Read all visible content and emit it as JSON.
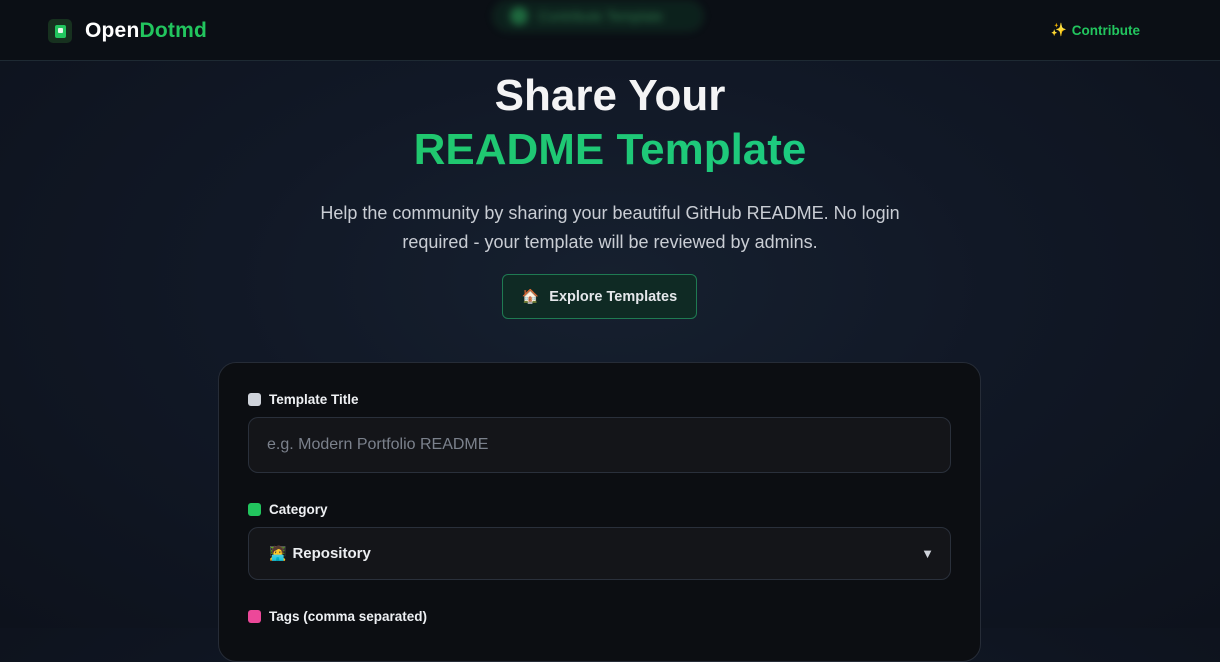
{
  "nav": {
    "brand_part1": "Open",
    "brand_part2": "Dotmd",
    "faded_pill_text": "Contribute Template",
    "contribute_label": "Contribute"
  },
  "hero": {
    "title_line1": "Share Your",
    "title_line2": "README Template",
    "subtitle": "Help the community by sharing your beautiful GitHub README. No login required - your template will be reviewed by admins.",
    "explore_button": "Explore Templates"
  },
  "form": {
    "title_label": "Template Title",
    "title_placeholder": "e.g. Modern Portfolio README",
    "title_value": "",
    "category_label": "Category",
    "category_selected": "Repository",
    "tags_label": "Tags (comma separated)"
  },
  "icons": {
    "logo": "book-icon",
    "contribute": "sparkle-icon",
    "explore": "house-icon",
    "title_label": "document-icon",
    "category_label": "palette-icon",
    "category_option": "person-at-computer-icon",
    "tags_label": "tag-icon",
    "select": "chevron-down-icon"
  },
  "colors": {
    "accent": "#22c55e",
    "accent_teal": "#10d2a0",
    "background": "#111826",
    "nav_background": "#0b0f15",
    "card_background": "#0c0e12"
  }
}
